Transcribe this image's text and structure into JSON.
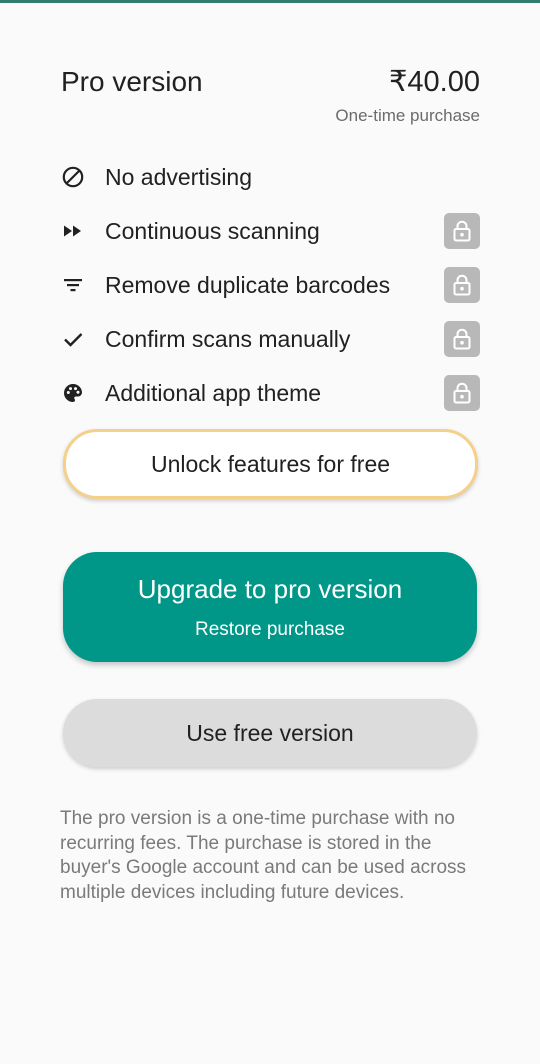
{
  "colors": {
    "accent": "#009688",
    "unlock_border": "#f4d08a",
    "lock_badge": "#b8b8b8",
    "free_button": "#dcdcdc"
  },
  "header": {
    "title": "Pro version",
    "price": "₹40.00",
    "price_note": "One-time purchase"
  },
  "features": [
    {
      "label": "No advertising",
      "icon": "block-icon",
      "locked": false
    },
    {
      "label": "Continuous scanning",
      "icon": "fast-forward-icon",
      "locked": true
    },
    {
      "label": "Remove duplicate barcodes",
      "icon": "filter-icon",
      "locked": true
    },
    {
      "label": "Confirm scans manually",
      "icon": "check-icon",
      "locked": true
    },
    {
      "label": "Additional app theme",
      "icon": "palette-icon",
      "locked": true
    }
  ],
  "buttons": {
    "unlock": "Unlock features for free",
    "upgrade": "Upgrade to pro version",
    "restore": "Restore purchase",
    "free": "Use free version"
  },
  "note": "The pro version is a one-time purchase with no recurring fees. The purchase is stored in the buyer's Google account and can be used across multiple devices including future devices."
}
